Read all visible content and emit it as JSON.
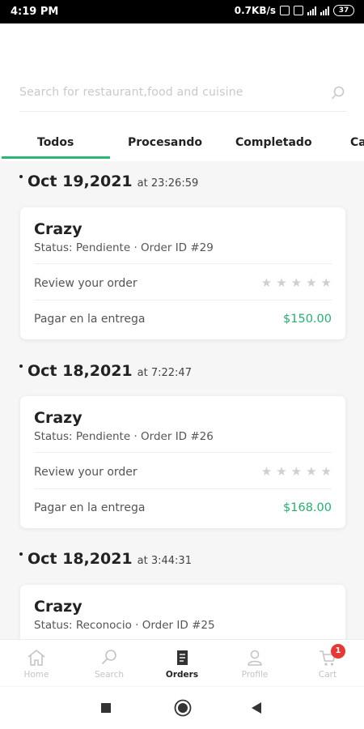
{
  "status_bar": {
    "time": "4:19 PM",
    "speed": "0.7KB/s",
    "battery": "37"
  },
  "search": {
    "placeholder": "Search for restaurant,food and cuisine"
  },
  "tabs": [
    "Todos",
    "Procesando",
    "Completado",
    "Ca"
  ],
  "orders": [
    {
      "date": "Oct 19,2021",
      "at": "at 23:26:59",
      "name": "Crazy",
      "status": "Status: Pendiente · Order ID #29",
      "review": "Review your order",
      "payment": "Pagar en la entrega",
      "price": "$150.00"
    },
    {
      "date": "Oct 18,2021",
      "at": "at 7:22:47",
      "name": "Crazy",
      "status": "Status: Pendiente · Order ID #26",
      "review": "Review your order",
      "payment": "Pagar en la entrega",
      "price": "$168.00"
    },
    {
      "date": "Oct 18,2021",
      "at": "at 3:44:31",
      "name": "Crazy",
      "status": "Status: Reconocio · Order ID #25"
    }
  ],
  "nav": {
    "items": [
      {
        "label": "Home",
        "icon": "home-icon"
      },
      {
        "label": "Search",
        "icon": "search-icon"
      },
      {
        "label": "Orders",
        "icon": "receipt-icon"
      },
      {
        "label": "Profile",
        "icon": "user-icon"
      },
      {
        "label": "Cart",
        "icon": "cart-icon"
      }
    ],
    "cart_badge": "1",
    "active": "Orders"
  },
  "colors": {
    "accent": "#2bb673",
    "price": "#23b26d",
    "badge": "#e53935"
  }
}
